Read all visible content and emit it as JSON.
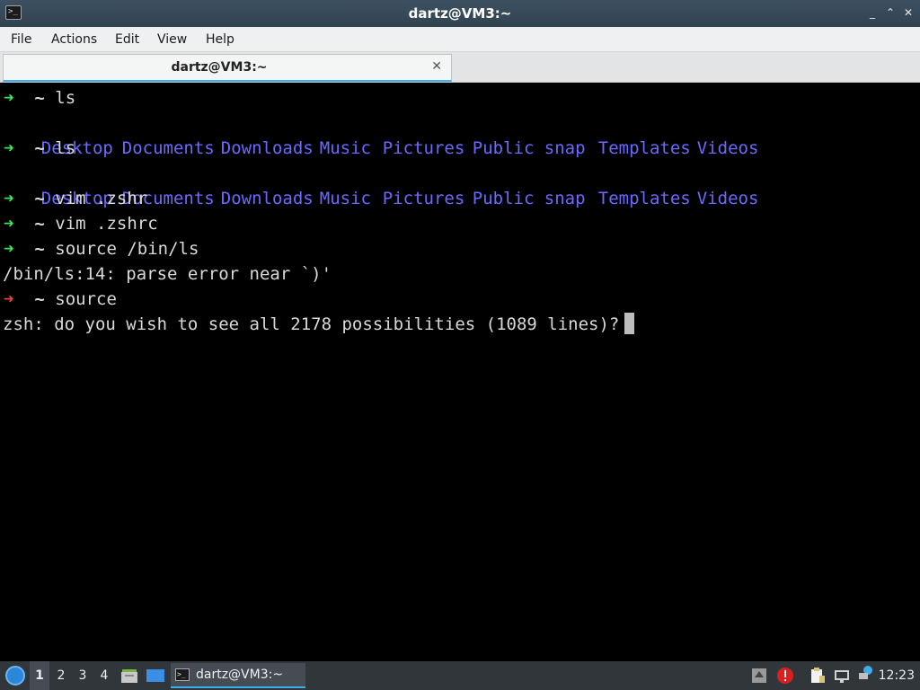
{
  "window": {
    "title": "dartz@VM3:~",
    "app_icon_glyph": ">_",
    "controls": {
      "minimize": "_",
      "maximize": "⌃",
      "close": "✕"
    }
  },
  "menu": [
    "File",
    "Actions",
    "Edit",
    "View",
    "Help"
  ],
  "tab": {
    "label": "dartz@VM3:~",
    "close_glyph": "✕"
  },
  "terminal": {
    "prompt_arrow": "➜",
    "prompt_dir": "~",
    "dirs": [
      "Desktop",
      "Documents",
      "Downloads",
      "Music",
      "Pictures",
      "Public",
      "snap",
      "Templates",
      "Videos"
    ],
    "cmd1": "ls",
    "cmd2": "ls",
    "cmd3": "vim .zshr",
    "cmd4": "vim .zshrc",
    "cmd5": "source /bin/ls",
    "error_line": "/bin/ls:14: parse error near `)'",
    "cmd6": "source",
    "question": "zsh: do you wish to see all 2178 possibilities (1089 lines)?"
  },
  "taskbar": {
    "desktops": [
      "1",
      "2",
      "3",
      "4"
    ],
    "active_desktop": "1",
    "task_label": "dartz@VM3:~",
    "task_icon_glyph": ">_",
    "clock": "12:23",
    "colors": {
      "accent": "#3daee9",
      "bar": "#31363b"
    }
  }
}
